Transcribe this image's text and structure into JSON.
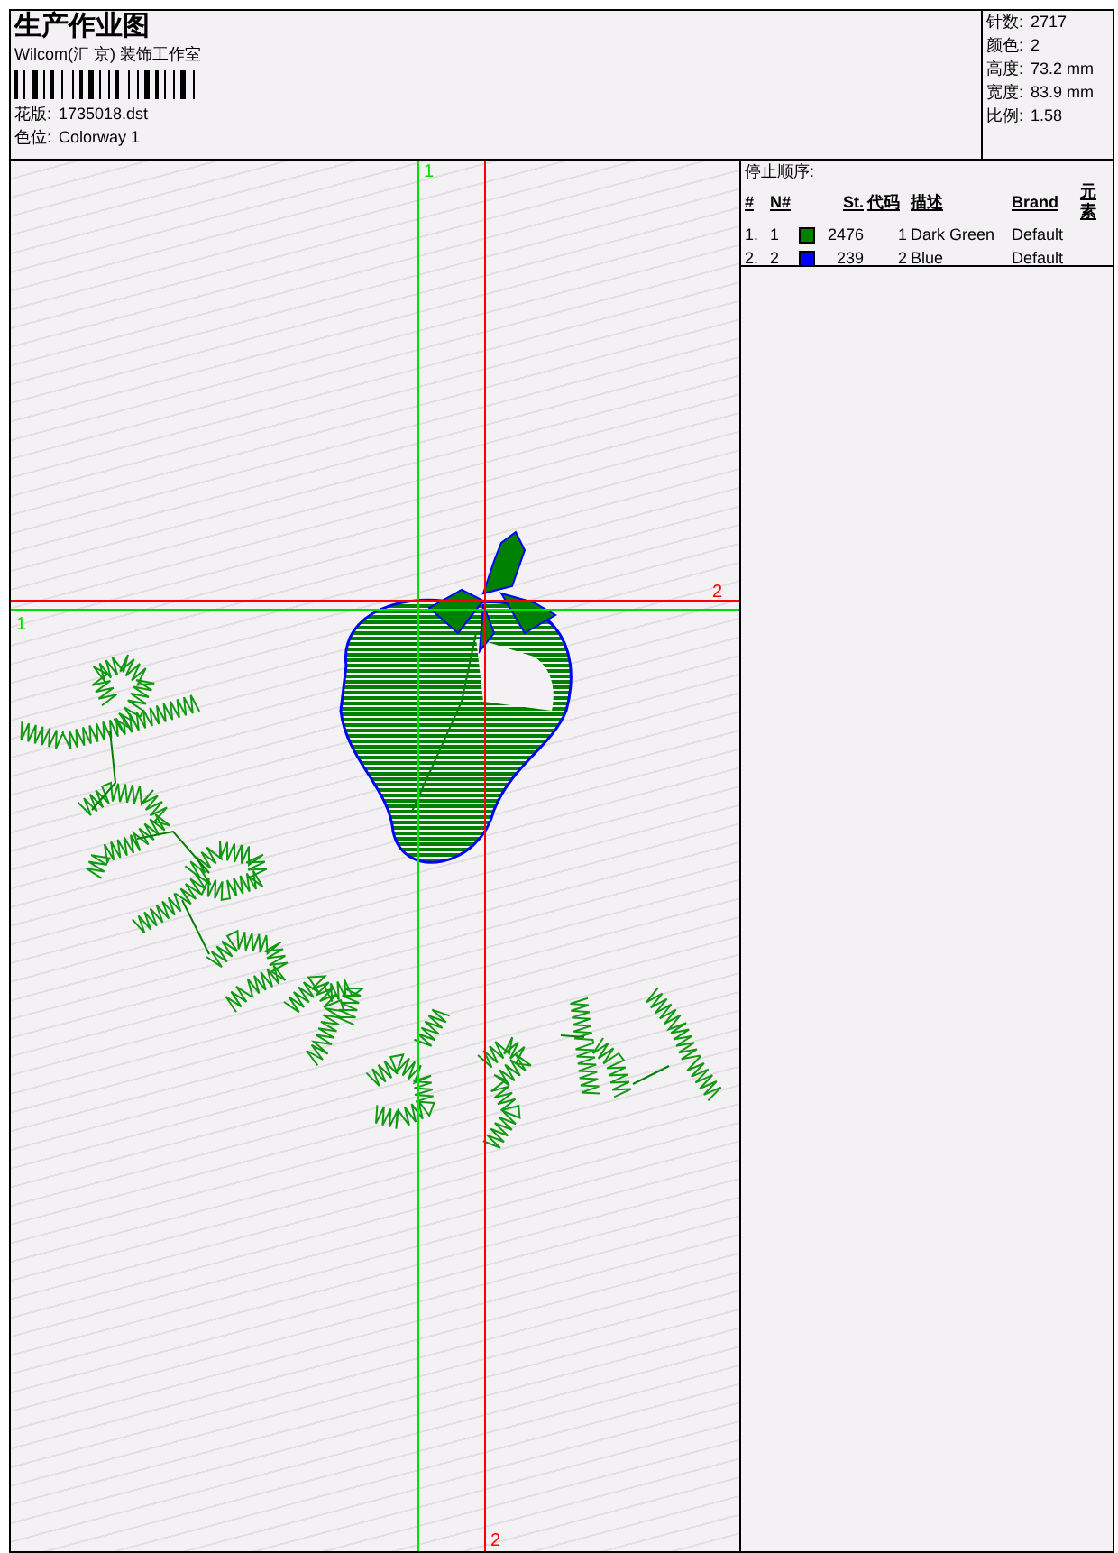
{
  "header": {
    "title": "生产作业图",
    "company": "Wilcom(汇 京) 装饰工作室",
    "design_label": "花版:",
    "design": "1735018.dst",
    "colorway_label": "色位:",
    "colorway": "Colorway 1"
  },
  "stats": [
    {
      "label": "针数:",
      "value": "2717"
    },
    {
      "label": "颜色:",
      "value": "2"
    },
    {
      "label": "高度:",
      "value": "73.2 mm"
    },
    {
      "label": "宽度:",
      "value": "83.9 mm"
    },
    {
      "label": "比例:",
      "value": "1.58"
    }
  ],
  "stop_sequence": {
    "title": "停止顺序:",
    "columns": [
      "#",
      "N#",
      "St.",
      "代码",
      "描述",
      "Brand",
      "元素"
    ],
    "rows": [
      {
        "index": "1.",
        "number": "1",
        "color": "#008000",
        "stitches": "2476",
        "code": "1",
        "description": "Dark Green",
        "brand": "Default"
      },
      {
        "index": "2.",
        "number": "2",
        "color": "#0000ff",
        "stitches": "239",
        "code": "2",
        "description": "Blue",
        "brand": "Default"
      }
    ]
  },
  "guides": [
    {
      "color": "#00e000",
      "labels": [
        "1",
        "1"
      ]
    },
    {
      "color": "#ff0000",
      "labels": [
        "2",
        "2"
      ]
    }
  ]
}
